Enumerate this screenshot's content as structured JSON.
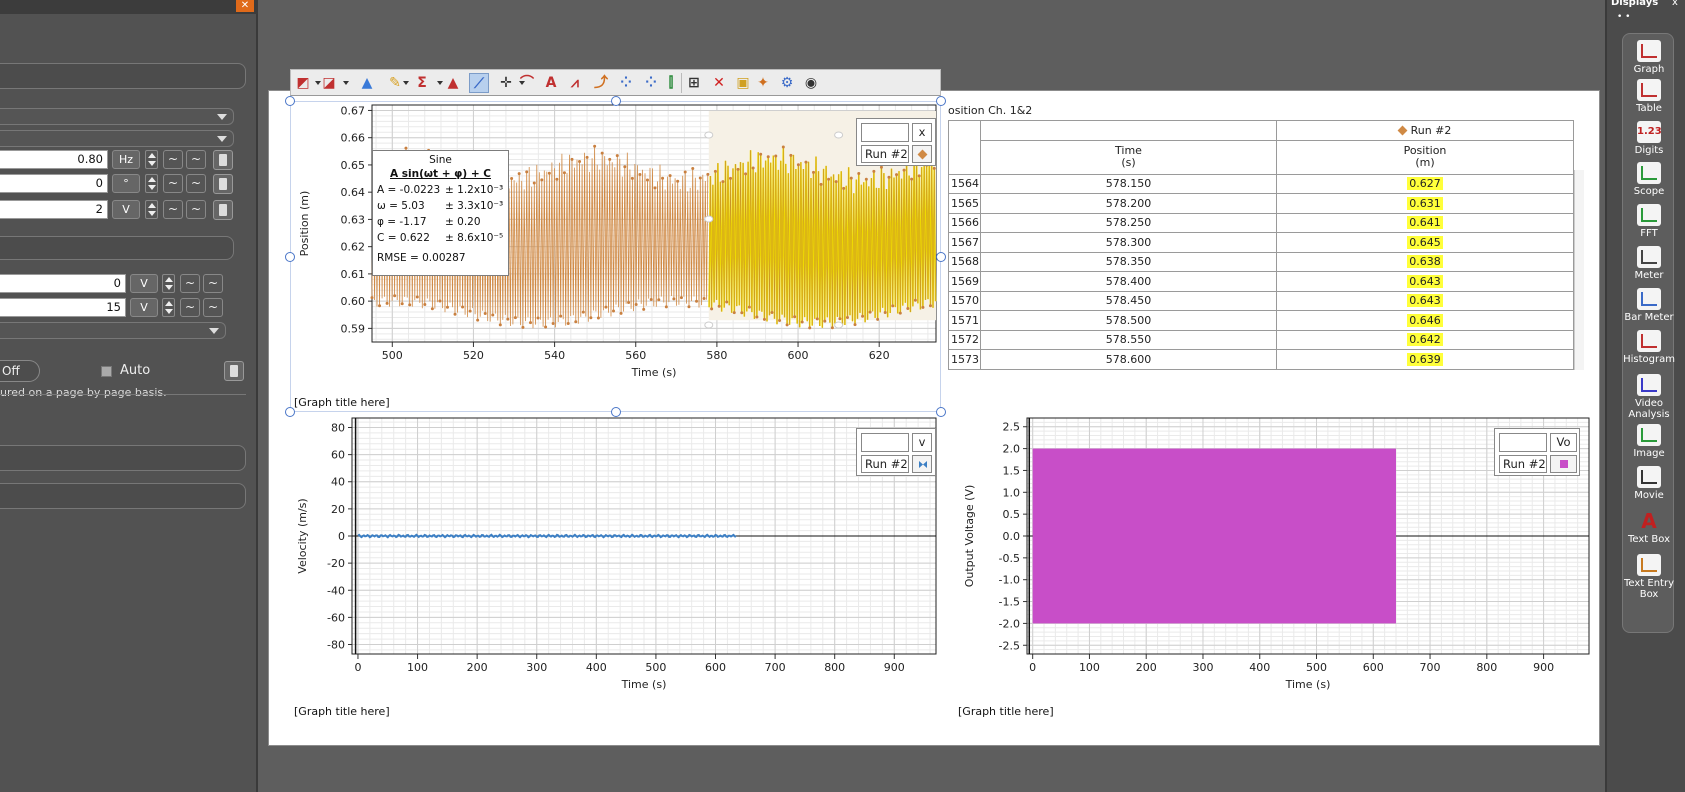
{
  "left_panel": {
    "inputs": [
      {
        "value": "0.80",
        "unit": "Hz"
      },
      {
        "value": "0",
        "unit": "°"
      },
      {
        "value": "2",
        "unit": "V"
      },
      {
        "value": "0",
        "unit": "V"
      },
      {
        "value": "15",
        "unit": "V"
      }
    ],
    "off_label": "Off",
    "auto_label": "Auto",
    "note": "ured on a page by page basis."
  },
  "right_panel": {
    "title": "Displays",
    "close": "x",
    "dots": "• •",
    "items": [
      {
        "label": "Graph",
        "icon": "graph-icon"
      },
      {
        "label": "Table",
        "icon": "table-icon"
      },
      {
        "label": "Digits",
        "icon": "digits-icon",
        "glyph": "1.23"
      },
      {
        "label": "Scope",
        "icon": "scope-icon"
      },
      {
        "label": "FFT",
        "icon": "fft-icon"
      },
      {
        "label": "Meter",
        "icon": "meter-icon"
      },
      {
        "label": "Bar Meter",
        "icon": "bar-meter-icon"
      },
      {
        "label": "Histogram",
        "icon": "histogram-icon"
      },
      {
        "label": "Video Analysis",
        "icon": "video-analysis-icon"
      },
      {
        "label": "Image",
        "icon": "image-icon"
      },
      {
        "label": "Movie",
        "icon": "movie-icon"
      },
      {
        "label": "Text Box",
        "icon": "text-box-icon",
        "glyph": "A"
      },
      {
        "label": "Text Entry Box",
        "icon": "text-entry-box-icon"
      }
    ]
  },
  "toolbar": {
    "buttons": [
      "scale-to-fit-icon",
      "graph-layout-icon",
      "data-browser-icon",
      "highlighter-icon",
      "statistics-icon",
      "area-icon",
      "curve-fit-icon",
      "coordinates-icon",
      "slope-icon",
      "annotation-icon",
      "smooth-icon",
      "tangent-icon",
      "add-point-icon",
      "remove-point-icon",
      "calculated-data-icon",
      "select-region-icon",
      "delete-icon",
      "duplicate-icon",
      "pin-icon",
      "settings-icon",
      "visibility-icon"
    ],
    "annotation_glyph": "A",
    "delete_glyph": "✕"
  },
  "graphs": {
    "position": {
      "title": "[Graph title here]",
      "legend_var": "x",
      "legend_run": "Run #2",
      "chart_data": {
        "type": "line",
        "xlabel": "Time (s)",
        "ylabel": "Position (m)",
        "x_ticks": [
          500,
          520,
          540,
          560,
          580,
          600,
          620
        ],
        "y_ticks": [
          0.59,
          0.6,
          0.61,
          0.62,
          0.63,
          0.64,
          0.65,
          0.66,
          0.67
        ],
        "xlim": [
          495,
          634
        ],
        "ylim": [
          0.585,
          0.672
        ],
        "series": [
          {
            "name": "Run #2",
            "color": "#d08a45",
            "x": [
              495,
              634
            ],
            "y_envelope_low": [
              0.596,
              0.598
            ],
            "y_envelope_high": [
              0.648,
              0.65
            ],
            "highlight_range": [
              578,
              634
            ],
            "highlight_color": "#ffee00"
          }
        ]
      },
      "fit": {
        "name": "Sine",
        "equation": "A sin(ωt + φ) + C",
        "rows": [
          {
            "param": "A",
            "value": "= -0.0223",
            "err": "± 1.2x10⁻³"
          },
          {
            "param": "ω",
            "value": "= 5.03",
            "err": "± 3.3x10⁻³"
          },
          {
            "param": "φ",
            "value": "= -1.17",
            "err": "± 0.20"
          },
          {
            "param": "C",
            "value": "= 0.622",
            "err": "± 8.6x10⁻⁵"
          }
        ],
        "rmse": "RMSE = 0.00287"
      }
    },
    "velocity": {
      "title": "[Graph title here]",
      "legend_var": "v",
      "legend_run": "Run #2",
      "chart_data": {
        "type": "line",
        "xlabel": "Time (s)",
        "ylabel": "Velocity (m/s)",
        "x_ticks": [
          0,
          100,
          200,
          300,
          400,
          500,
          600,
          700,
          800,
          900
        ],
        "y_ticks": [
          -80,
          -60,
          -40,
          -20,
          0,
          20,
          40,
          60,
          80
        ],
        "xlim": [
          -10,
          970
        ],
        "ylim": [
          -87,
          87
        ],
        "series": [
          {
            "name": "Run #2",
            "color": "#3c7fc4",
            "x": [
              0,
              635
            ],
            "y": [
              0,
              0
            ]
          }
        ]
      }
    },
    "voltage": {
      "title": "[Graph title here]",
      "legend_var": "Vo",
      "legend_run": "Run #2",
      "chart_data": {
        "type": "area",
        "xlabel": "Time (s)",
        "ylabel": "Output Voltage (V)",
        "x_ticks": [
          0,
          100,
          200,
          300,
          400,
          500,
          600,
          700,
          800,
          900
        ],
        "y_ticks": [
          -2.5,
          -2.0,
          -1.5,
          -1.0,
          -0.5,
          0.0,
          0.5,
          1.0,
          1.5,
          2.0,
          2.5
        ],
        "xlim": [
          -10,
          980
        ],
        "ylim": [
          -2.7,
          2.7
        ],
        "series": [
          {
            "name": "Run #2",
            "color": "#c84ec8",
            "x": [
              0,
              640
            ],
            "y_min": -2.0,
            "y_max": 2.0
          }
        ]
      }
    }
  },
  "table": {
    "title": "osition Ch. 1&2",
    "run_header": "Run #2",
    "columns": [
      {
        "name": "Time",
        "unit": "(s)"
      },
      {
        "name": "Position",
        "unit": "(m)"
      }
    ],
    "rows": [
      {
        "idx": "1564",
        "time": "578.150",
        "pos": "0.627"
      },
      {
        "idx": "1565",
        "time": "578.200",
        "pos": "0.631"
      },
      {
        "idx": "1566",
        "time": "578.250",
        "pos": "0.641"
      },
      {
        "idx": "1567",
        "time": "578.300",
        "pos": "0.645"
      },
      {
        "idx": "1568",
        "time": "578.350",
        "pos": "0.638"
      },
      {
        "idx": "1569",
        "time": "578.400",
        "pos": "0.643"
      },
      {
        "idx": "1570",
        "time": "578.450",
        "pos": "0.643"
      },
      {
        "idx": "1571",
        "time": "578.500",
        "pos": "0.646"
      },
      {
        "idx": "1572",
        "time": "578.550",
        "pos": "0.642"
      },
      {
        "idx": "1573",
        "time": "578.600",
        "pos": "0.639"
      }
    ]
  }
}
